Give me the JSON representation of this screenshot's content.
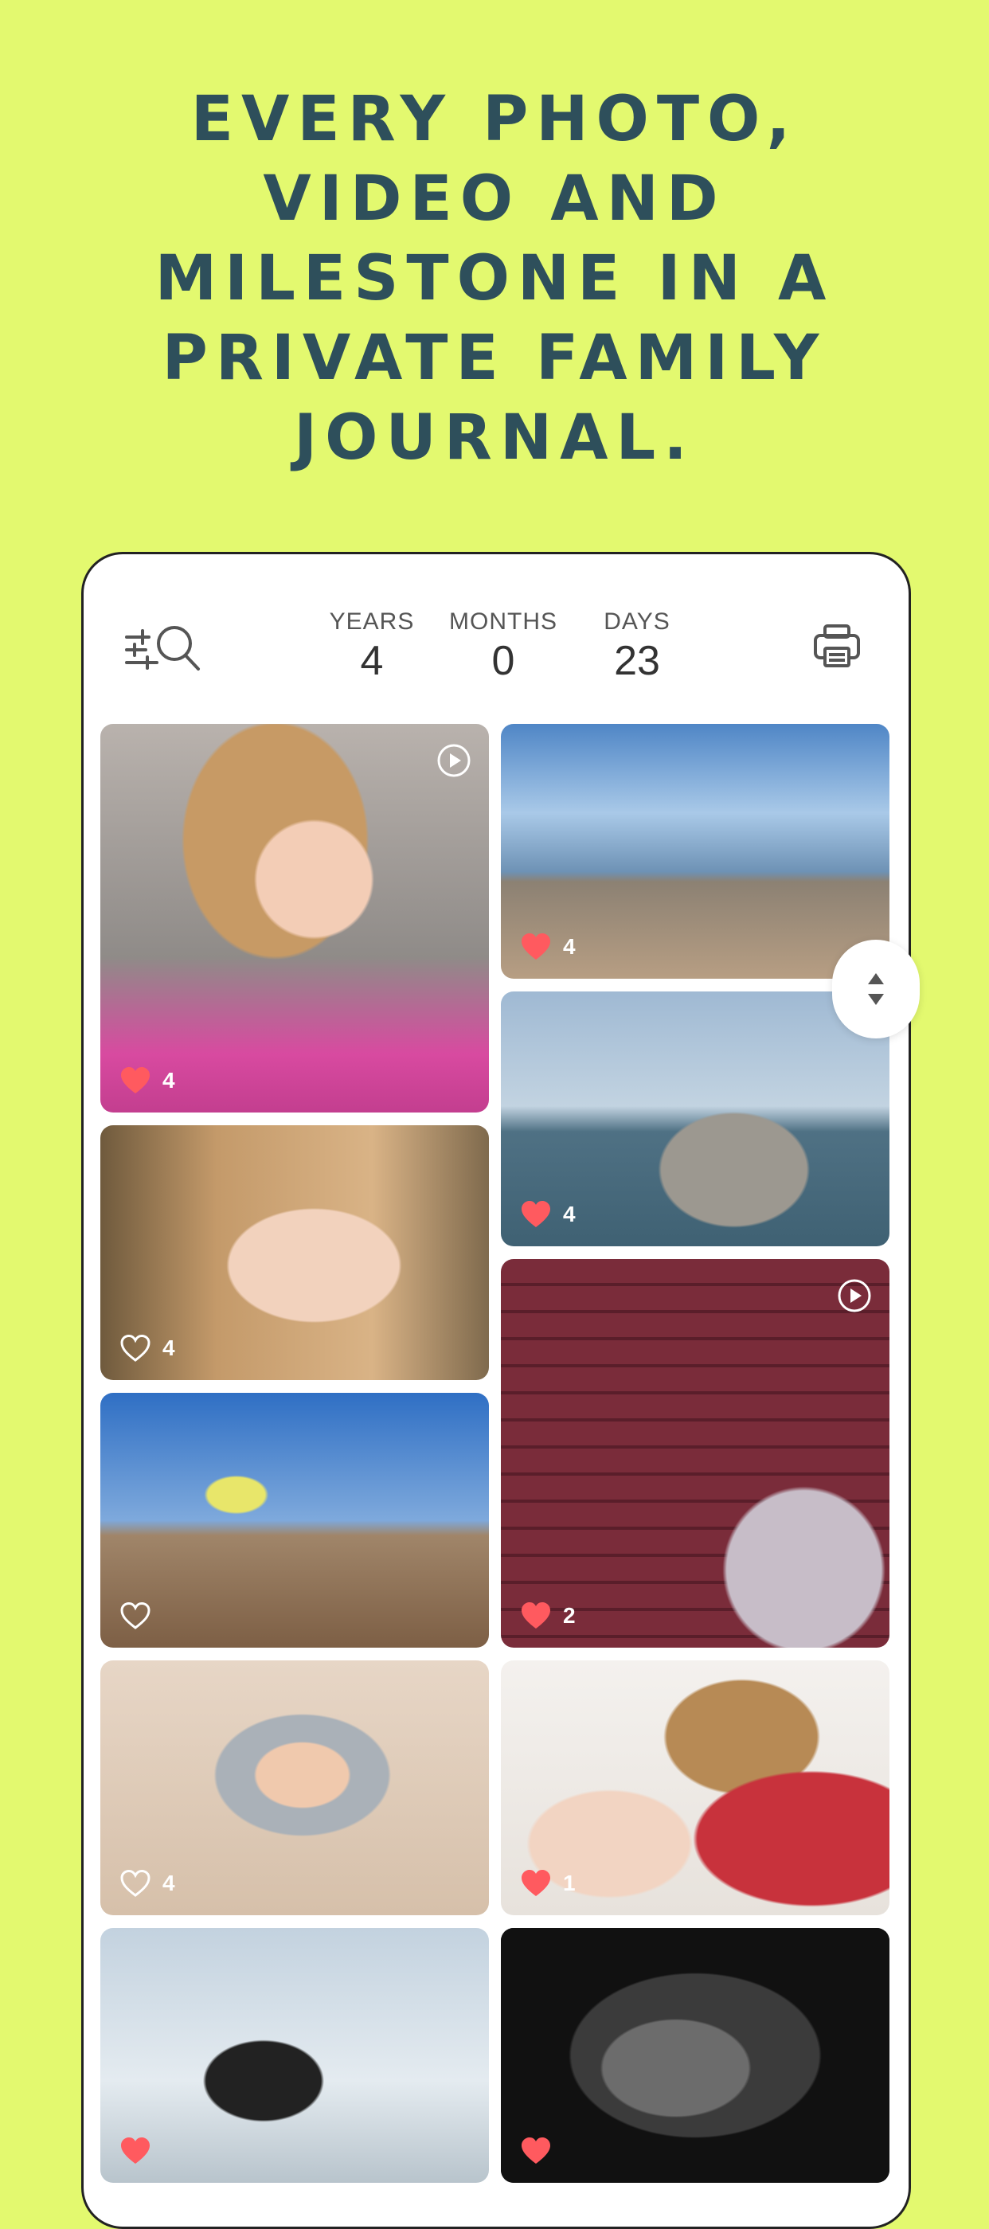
{
  "headline": [
    "EVERY PHOTO,",
    "VIDEO AND",
    "MILESTONE IN A",
    "PRIVATE FAMILY",
    "JOURNAL."
  ],
  "age": {
    "years_label": "YEARS",
    "years": "4",
    "months_label": "MONTHS",
    "months": "0",
    "days_label": "DAYS",
    "days": "23"
  },
  "icons": {
    "filter": "filter-search-icon",
    "print": "printer-icon",
    "scroll": "scroll-updown-icon",
    "heart_filled": "heart-filled-icon",
    "heart_outline": "heart-outline-icon",
    "play": "play-circle-icon"
  },
  "tiles": [
    {
      "subject": "girl-bunny-ears",
      "likes": "4",
      "liked": true,
      "video": true
    },
    {
      "subject": "child-jumping-beach",
      "likes": "4",
      "liked": true,
      "video": false
    },
    {
      "subject": "father-daughter-sea",
      "likes": "4",
      "liked": true,
      "video": false
    },
    {
      "subject": "girl-portrait",
      "likes": "4",
      "liked": false,
      "video": false
    },
    {
      "subject": "red-fence-bubble",
      "likes": "2",
      "liked": true,
      "video": true
    },
    {
      "subject": "toddler-beach-walk",
      "likes": "",
      "liked": false,
      "video": false
    },
    {
      "subject": "baby-helmet",
      "likes": "4",
      "liked": false,
      "video": false
    },
    {
      "subject": "boy-kissing-baby",
      "likes": "1",
      "liked": true,
      "video": false
    },
    {
      "subject": "pregnant-mother",
      "likes": "",
      "liked": true,
      "video": false
    },
    {
      "subject": "ultrasound-scan",
      "likes": "",
      "liked": true,
      "video": false
    }
  ],
  "colors": {
    "background": "#e3f96f",
    "headline": "#2e4f5b",
    "heart": "#ff5a5f"
  }
}
